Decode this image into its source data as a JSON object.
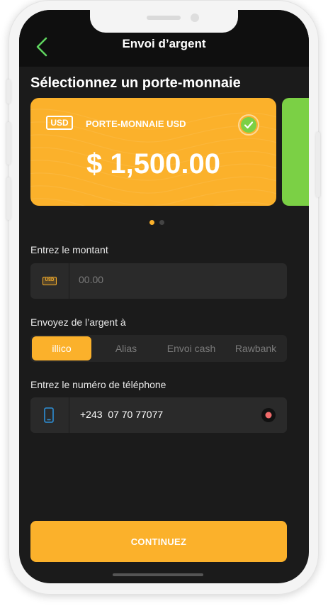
{
  "header": {
    "title": "Envoi d’argent"
  },
  "wallet_section": {
    "title": "Sélectionnez un porte-monnaie",
    "cards": [
      {
        "currency_badge": "USD",
        "name": "PORTE-MONNAIE USD",
        "balance": "$ 1,500.00",
        "selected": true,
        "color": "#fbb12b"
      },
      {
        "color": "#7bd045"
      }
    ],
    "pager": {
      "count": 2,
      "active_index": 0
    }
  },
  "amount": {
    "label": "Entrez le montant",
    "currency_icon": "USD",
    "placeholder": "00.00",
    "value": ""
  },
  "send_to": {
    "label": "Envoyez de l’argent à",
    "tabs": [
      {
        "label": "illico",
        "active": true
      },
      {
        "label": "Alias",
        "active": false
      },
      {
        "label": "Envoi cash",
        "active": false
      },
      {
        "label": "Rawbank",
        "active": false
      }
    ]
  },
  "phone": {
    "label": "Entrez le numéro de téléphone",
    "value": "+243  07 70 77077"
  },
  "continue_button": {
    "label": "CONTINUEZ"
  },
  "colors": {
    "accent": "#fbb12b",
    "back_arrow": "#5fd35f",
    "check": "#7bd045",
    "background": "#1b1b1b",
    "field": "#2a2a2a"
  }
}
